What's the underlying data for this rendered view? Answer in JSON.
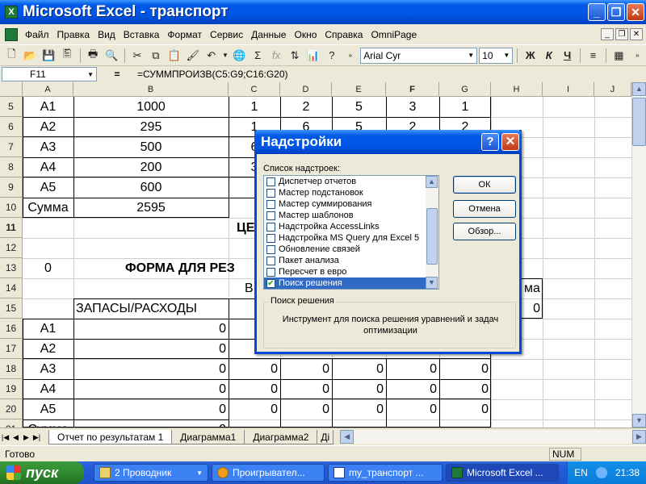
{
  "window": {
    "title": "Microsoft Excel - транспорт"
  },
  "menu": [
    "Файл",
    "Правка",
    "Вид",
    "Вставка",
    "Формат",
    "Сервис",
    "Данные",
    "Окно",
    "Справка",
    "OmniPage"
  ],
  "toolbar": {
    "font_name": "Arial Cyr",
    "font_size": "10",
    "bold": "Ж",
    "italic": "К",
    "underline": "Ч"
  },
  "formula_bar": {
    "name_box": "F11",
    "fx": "=",
    "formula": "=СУММПРОИЗВ(C5:G9;C16:G20)"
  },
  "columns": [
    "A",
    "B",
    "C",
    "D",
    "E",
    "F",
    "G",
    "H",
    "I",
    "J"
  ],
  "rows": [
    "5",
    "6",
    "7",
    "8",
    "9",
    "10",
    "11",
    "12",
    "13",
    "14",
    "15",
    "16",
    "17",
    "18",
    "19",
    "20",
    "21"
  ],
  "cells": {
    "r5": [
      "A1",
      "1000",
      "1",
      "2",
      "5",
      "3",
      "1"
    ],
    "r6": [
      "A2",
      "295",
      "1",
      "6",
      "5",
      "2",
      "2"
    ],
    "r7": [
      "A3",
      "500",
      "6"
    ],
    "r8": [
      "A4",
      "200",
      "3"
    ],
    "r9": [
      "A5",
      "600"
    ],
    "r10": [
      "Сумма",
      "2595"
    ],
    "r11_text": "ЦЕ",
    "r13_a": "0",
    "r13_text": "ФОРМА ДЛЯ РЕЗ",
    "r14_c": "В",
    "r14_h": "ма",
    "r15_b": "ЗАПАСЫ/РАСХОДЫ",
    "r15_h": "0",
    "r16": [
      "A1",
      "0"
    ],
    "r17": [
      "A2",
      "0"
    ],
    "r18": [
      "A3",
      "0",
      "0",
      "0",
      "0",
      "0",
      "0"
    ],
    "r19": [
      "A4",
      "0",
      "0",
      "0",
      "0",
      "0",
      "0"
    ],
    "r20": [
      "A5",
      "0",
      "0",
      "0",
      "0",
      "0",
      "0"
    ],
    "r21": [
      "Сумма",
      "0"
    ]
  },
  "sheet_tabs": [
    "Отчет по результатам 1",
    "Диаграмма1",
    "Диаграмма2",
    "Ді"
  ],
  "status": {
    "text": "Готово",
    "num": "NUM"
  },
  "dialog": {
    "title": "Надстройки",
    "list_label": "Список надстроек:",
    "items": [
      {
        "label": "Диспетчер отчетов",
        "checked": false
      },
      {
        "label": "Мастер подстановок",
        "checked": false
      },
      {
        "label": "Мастер суммирования",
        "checked": false
      },
      {
        "label": "Мастер шаблонов",
        "checked": false
      },
      {
        "label": "Надстройка AccessLinks",
        "checked": false
      },
      {
        "label": "Надстройка MS Query для Excel 5",
        "checked": false
      },
      {
        "label": "Обновление связей",
        "checked": false
      },
      {
        "label": "Пакет анализа",
        "checked": false
      },
      {
        "label": "Пересчет в евро",
        "checked": false
      },
      {
        "label": "Поиск решения",
        "checked": true,
        "selected": true
      }
    ],
    "buttons": {
      "ok": "ОК",
      "cancel": "Отмена",
      "browse": "Обзор..."
    },
    "group_label": "Поиск решения",
    "description": "Инструмент для поиска решения уравнений и задач оптимизации"
  },
  "taskbar": {
    "start": "пуск",
    "tasks": [
      "2 Проводник",
      "Проигрывател...",
      "my_транспорт ...",
      "Microsoft Excel ..."
    ],
    "lang": "EN",
    "clock": "21:38"
  }
}
